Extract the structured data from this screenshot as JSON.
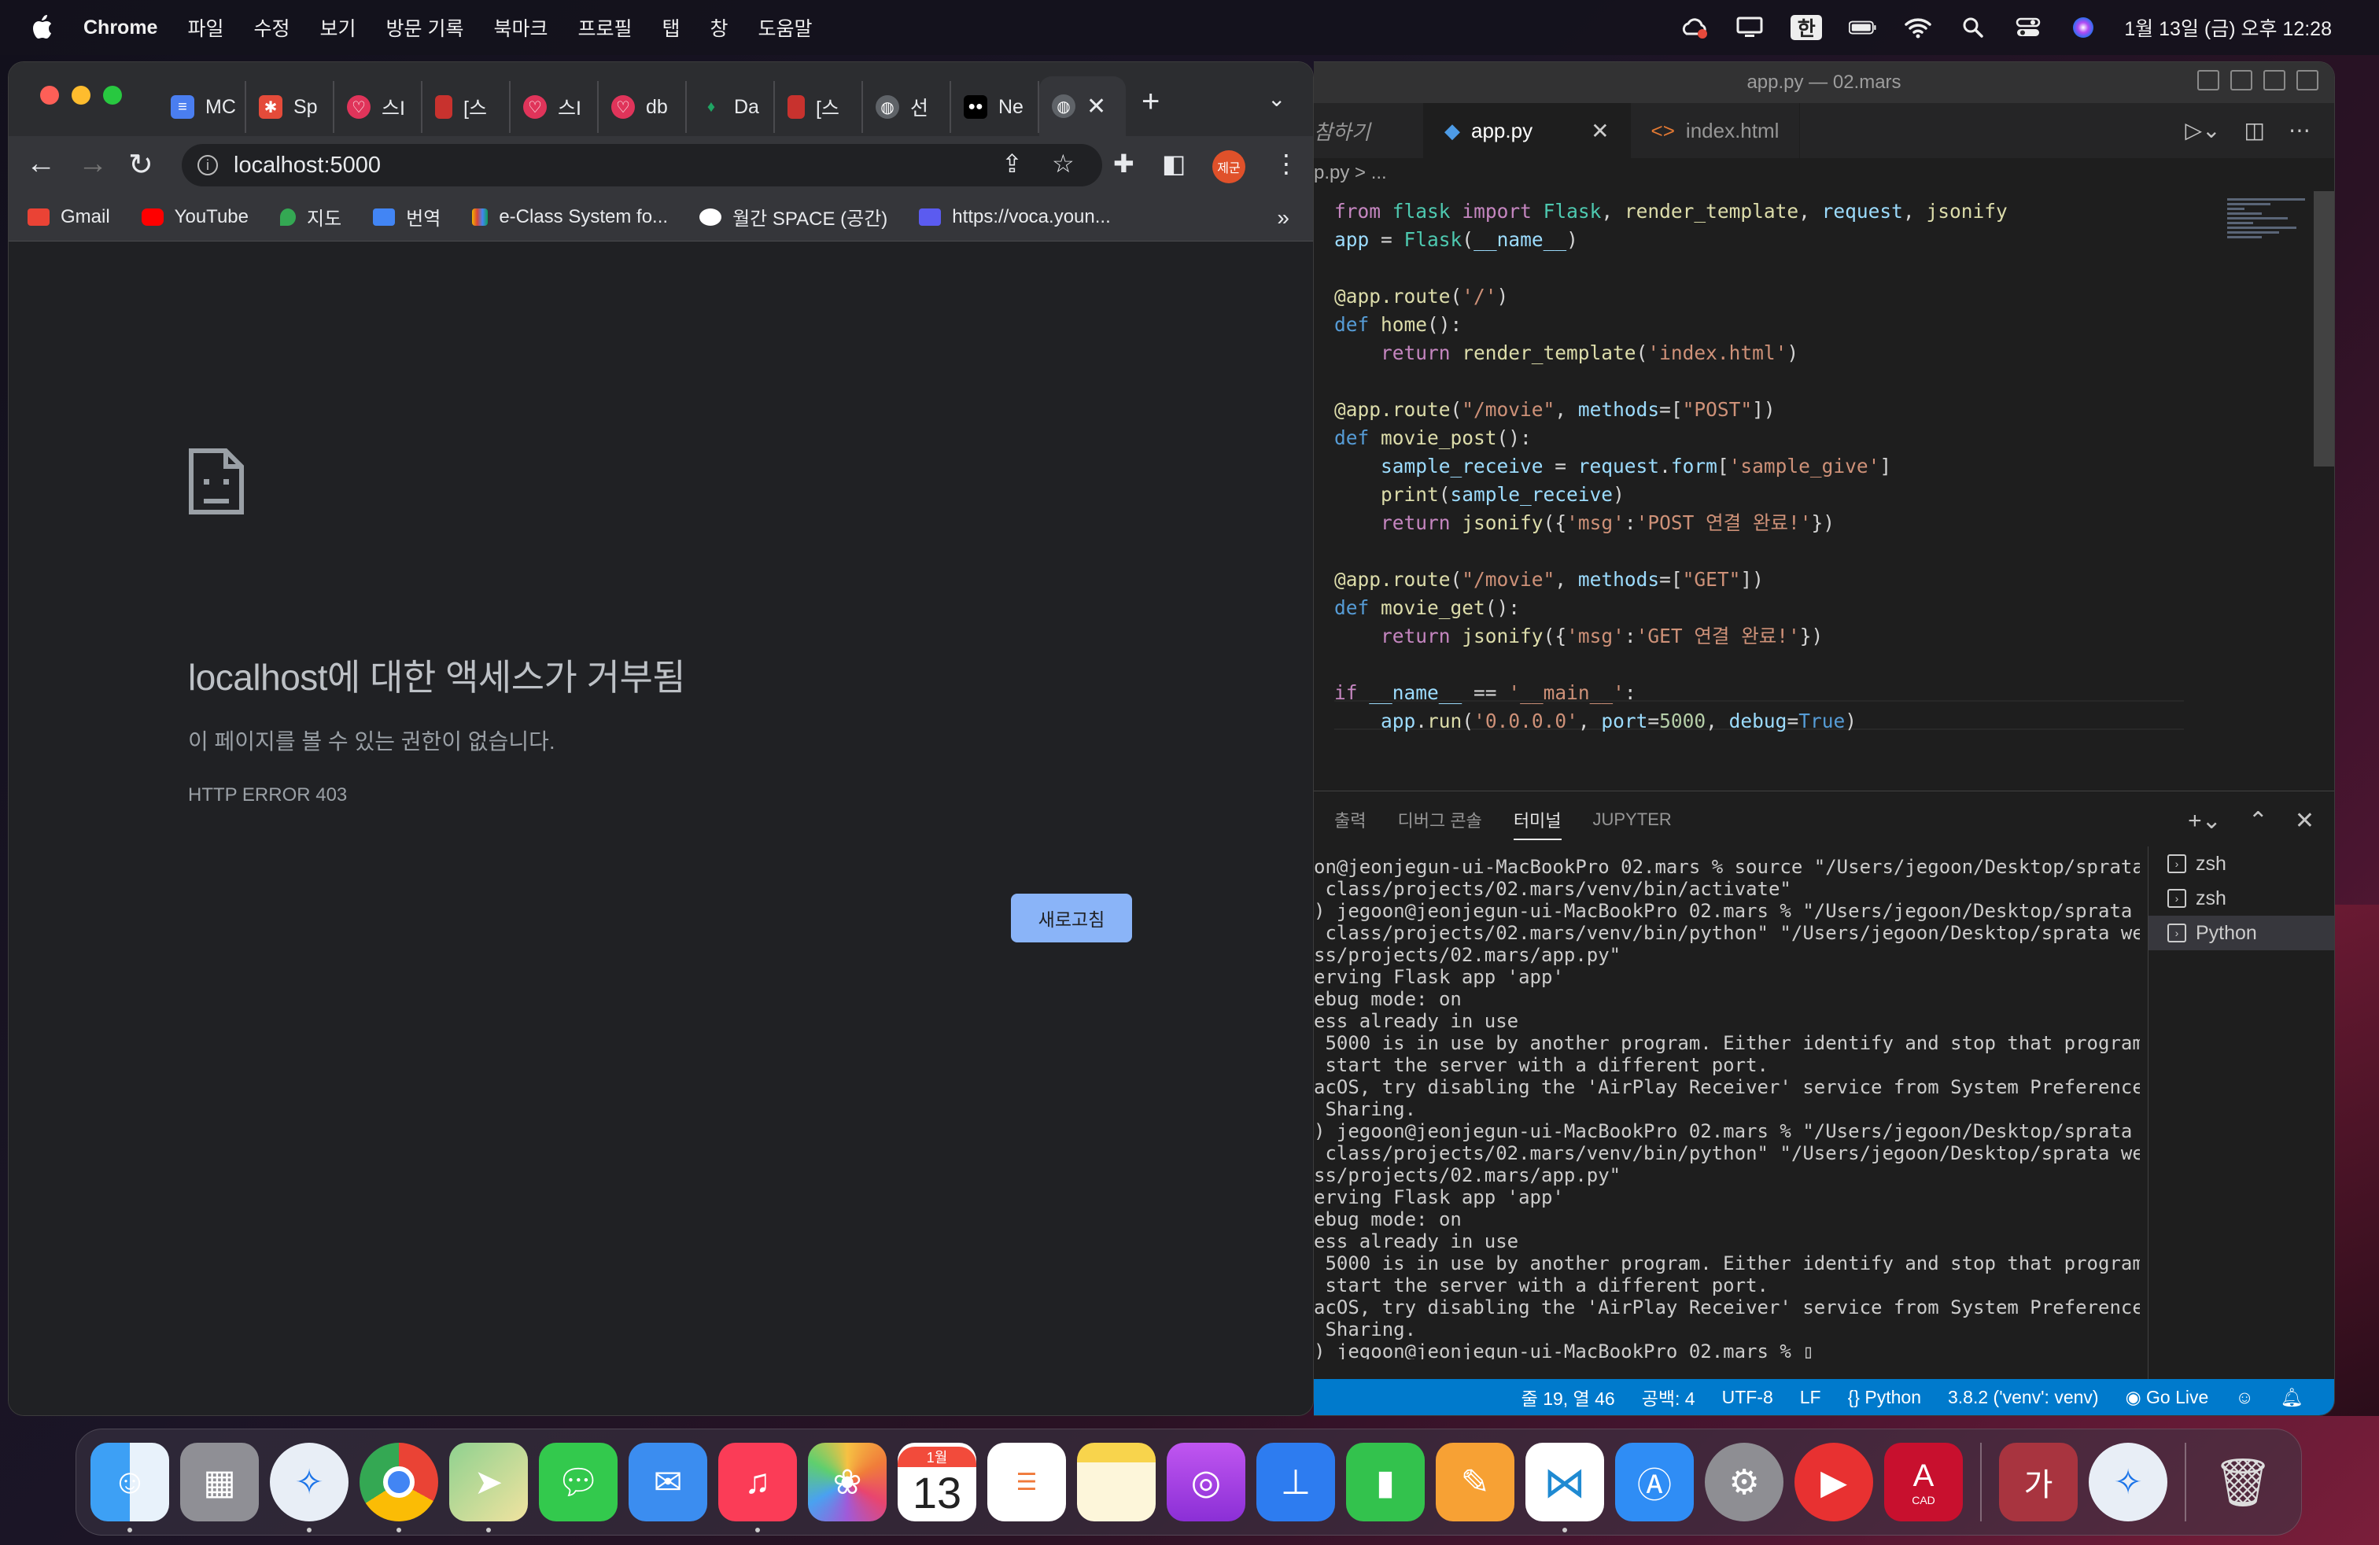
{
  "menubar": {
    "app_name": "Chrome",
    "items": [
      "파일",
      "수정",
      "보기",
      "방문 기록",
      "북마크",
      "프로필",
      "탭",
      "창",
      "도움말"
    ],
    "ime": "한",
    "datetime": "1월 13일 (금) 오후 12:28"
  },
  "chrome": {
    "tabs": [
      {
        "label": "MC",
        "color": "#4a7ef0"
      },
      {
        "label": "Sp",
        "color": "#e44b3a"
      },
      {
        "label": "스I",
        "color": "#e0345a"
      },
      {
        "label": "[스",
        "color": "#c8322e"
      },
      {
        "label": "스I",
        "color": "#e0345a"
      },
      {
        "label": "db",
        "color": "#e0345a"
      },
      {
        "label": "Da",
        "color": "#1fa463"
      },
      {
        "label": "[스",
        "color": "#c8322e"
      },
      {
        "label": "선",
        "color": "#9aa0a6"
      },
      {
        "label": "Ne",
        "color": "#000000"
      }
    ],
    "url": "localhost:5000",
    "profile_label": "제군",
    "bookmarks": [
      "Gmail",
      "YouTube",
      "지도",
      "번역",
      "e-Class System fo...",
      "월간 SPACE (공간)",
      "https://voca.youn..."
    ],
    "error": {
      "title": "localhost에 대한 액세스가 거부됨",
      "description": "이 페이지를 볼 수 있는 권한이 없습니다.",
      "code": "HTTP ERROR 403",
      "reload_label": "새로고침"
    }
  },
  "vscode": {
    "window_title": "app.py — 02.mars",
    "tabs": [
      {
        "label": "참하기"
      },
      {
        "label": "app.py"
      },
      {
        "label": "index.html"
      }
    ],
    "breadcrumb": "p.py > ...",
    "panel_tabs": [
      "출력",
      "디버그 콘솔",
      "터미널",
      "JUPYTER"
    ],
    "terminal_lines": [
      "on@jeonjegun-ui-MacBookPro 02.mars % source \"/Users/jegoon/Desktop/sprata",
      " class/projects/02.mars/venv/bin/activate\"",
      ") jegoon@jeonjegun-ui-MacBookPro 02.mars % \"/Users/jegoon/Desktop/sprata",
      " class/projects/02.mars/venv/bin/python\" \"/Users/jegoon/Desktop/sprata we",
      "ss/projects/02.mars/app.py\"",
      "erving Flask app 'app'",
      "ebug mode: on",
      "ess already in use",
      " 5000 is in use by another program. Either identify and stop that program",
      " start the server with a different port.",
      "acOS, try disabling the 'AirPlay Receiver' service from System Preference",
      " Sharing.",
      ") jegoon@jeonjegun-ui-MacBookPro 02.mars % \"/Users/jegoon/Desktop/sprata",
      " class/projects/02.mars/venv/bin/python\" \"/Users/jegoon/Desktop/sprata we",
      "ss/projects/02.mars/app.py\"",
      "erving Flask app 'app'",
      "ebug mode: on",
      "ess already in use",
      " 5000 is in use by another program. Either identify and stop that program",
      " start the server with a different port.",
      "acOS, try disabling the 'AirPlay Receiver' service from System Preference",
      " Sharing.",
      ") jegoon@jeonjegun-ui-MacBookPro 02.mars % ▯"
    ],
    "terminals": [
      "zsh",
      "zsh",
      "Python"
    ],
    "status": {
      "position": "줄 19, 열 46",
      "spaces": "공백: 4",
      "encoding": "UTF-8",
      "eol": "LF",
      "language": "Python",
      "interpreter": "3.8.2 ('venv': venv)",
      "golive": "Go Live"
    }
  },
  "dock": {
    "calendar_month": "1월",
    "calendar_day": "13",
    "autocad_label": "CAD",
    "korean_app": "가"
  }
}
